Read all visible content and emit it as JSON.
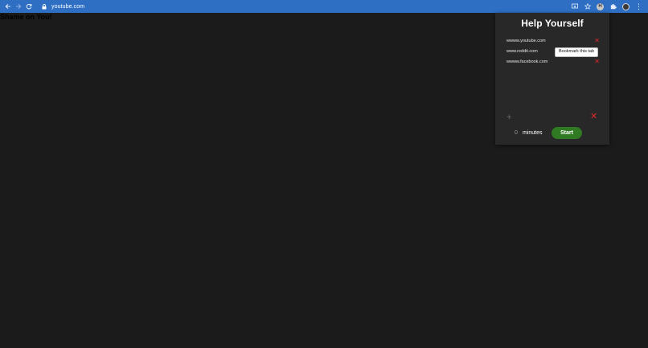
{
  "browser": {
    "url": "youtube.com",
    "extension_badge": "H"
  },
  "page": {
    "message": "Shame on You!"
  },
  "popup": {
    "title": "Help Yourself",
    "sites": [
      {
        "label": "wwww.youtube.com",
        "action": "remove"
      },
      {
        "label": "www.reddit.com",
        "action": "bookmark"
      },
      {
        "label": "wwww.facebook.com",
        "action": "remove"
      }
    ],
    "bookmark_label": "Bookmark this tab",
    "add_symbol": "+",
    "clear_symbol": "✕",
    "remove_symbol": "✕",
    "minutes_value": "0",
    "minutes_label": "minutes",
    "start_label": "Start"
  },
  "colors": {
    "toolbar": "#2e6fc4",
    "page_background": "#1b1b1b",
    "popup_background": "#282828",
    "remove_red": "#e0262b",
    "start_green": "#2f7a22"
  }
}
